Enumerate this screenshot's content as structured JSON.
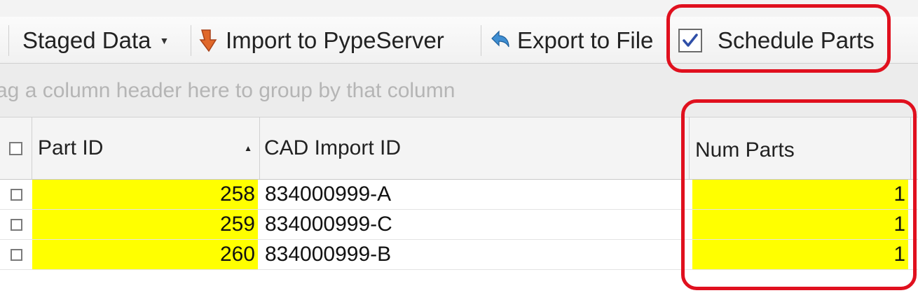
{
  "toolbar": {
    "staged_data_label": "Staged Data",
    "import_label": "Import to PypeServer",
    "export_label": "Export to File",
    "schedule_parts_label": "Schedule Parts",
    "schedule_parts_checked": true
  },
  "group_panel": {
    "hint": "ag a column header here to group by that column"
  },
  "grid": {
    "columns": [
      "Part ID",
      "CAD Import ID",
      "Num Parts"
    ],
    "sort_column": "Part ID",
    "sort_direction": "ascending",
    "rows": [
      {
        "part_id": "258",
        "cad_import_id": "834000999-A",
        "num_parts": "1"
      },
      {
        "part_id": "259",
        "cad_import_id": "834000999-C",
        "num_parts": "1"
      },
      {
        "part_id": "260",
        "cad_import_id": "834000999-B",
        "num_parts": "1"
      }
    ]
  },
  "colors": {
    "highlight": "#ffff00",
    "annotation_red": "#e0101e"
  }
}
